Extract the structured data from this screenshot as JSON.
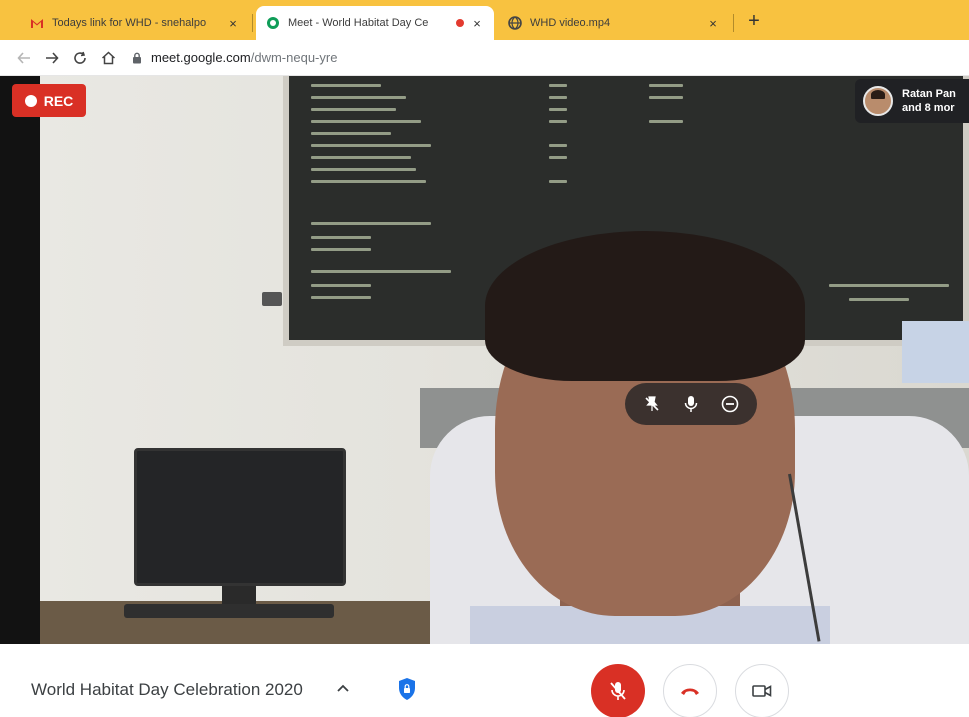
{
  "browser": {
    "tabs": [
      {
        "title": "Todays link for WHD - snehalpo",
        "icon": "gmail-icon",
        "active": false
      },
      {
        "title": "Meet - World Habitat Day Ce",
        "icon": "meet-icon",
        "active": true,
        "recording_indicator": true
      },
      {
        "title": "WHD video.mp4",
        "icon": "globe-icon",
        "active": false
      }
    ],
    "close_glyph": "×",
    "new_tab_glyph": "+",
    "address": {
      "host": "meet.google.com",
      "path": "/dwm-nequ-yre"
    }
  },
  "meet": {
    "rec_label": "REC",
    "participants_line1": "Ratan Pan",
    "participants_line2": "and 8 mor",
    "meeting_title": "World Habitat Day Celebration 2020",
    "colors": {
      "rec_red": "#d93025",
      "tab_strip": "#f8c240",
      "shield_blue": "#1a73e8",
      "dark_pill": "#202124"
    }
  }
}
